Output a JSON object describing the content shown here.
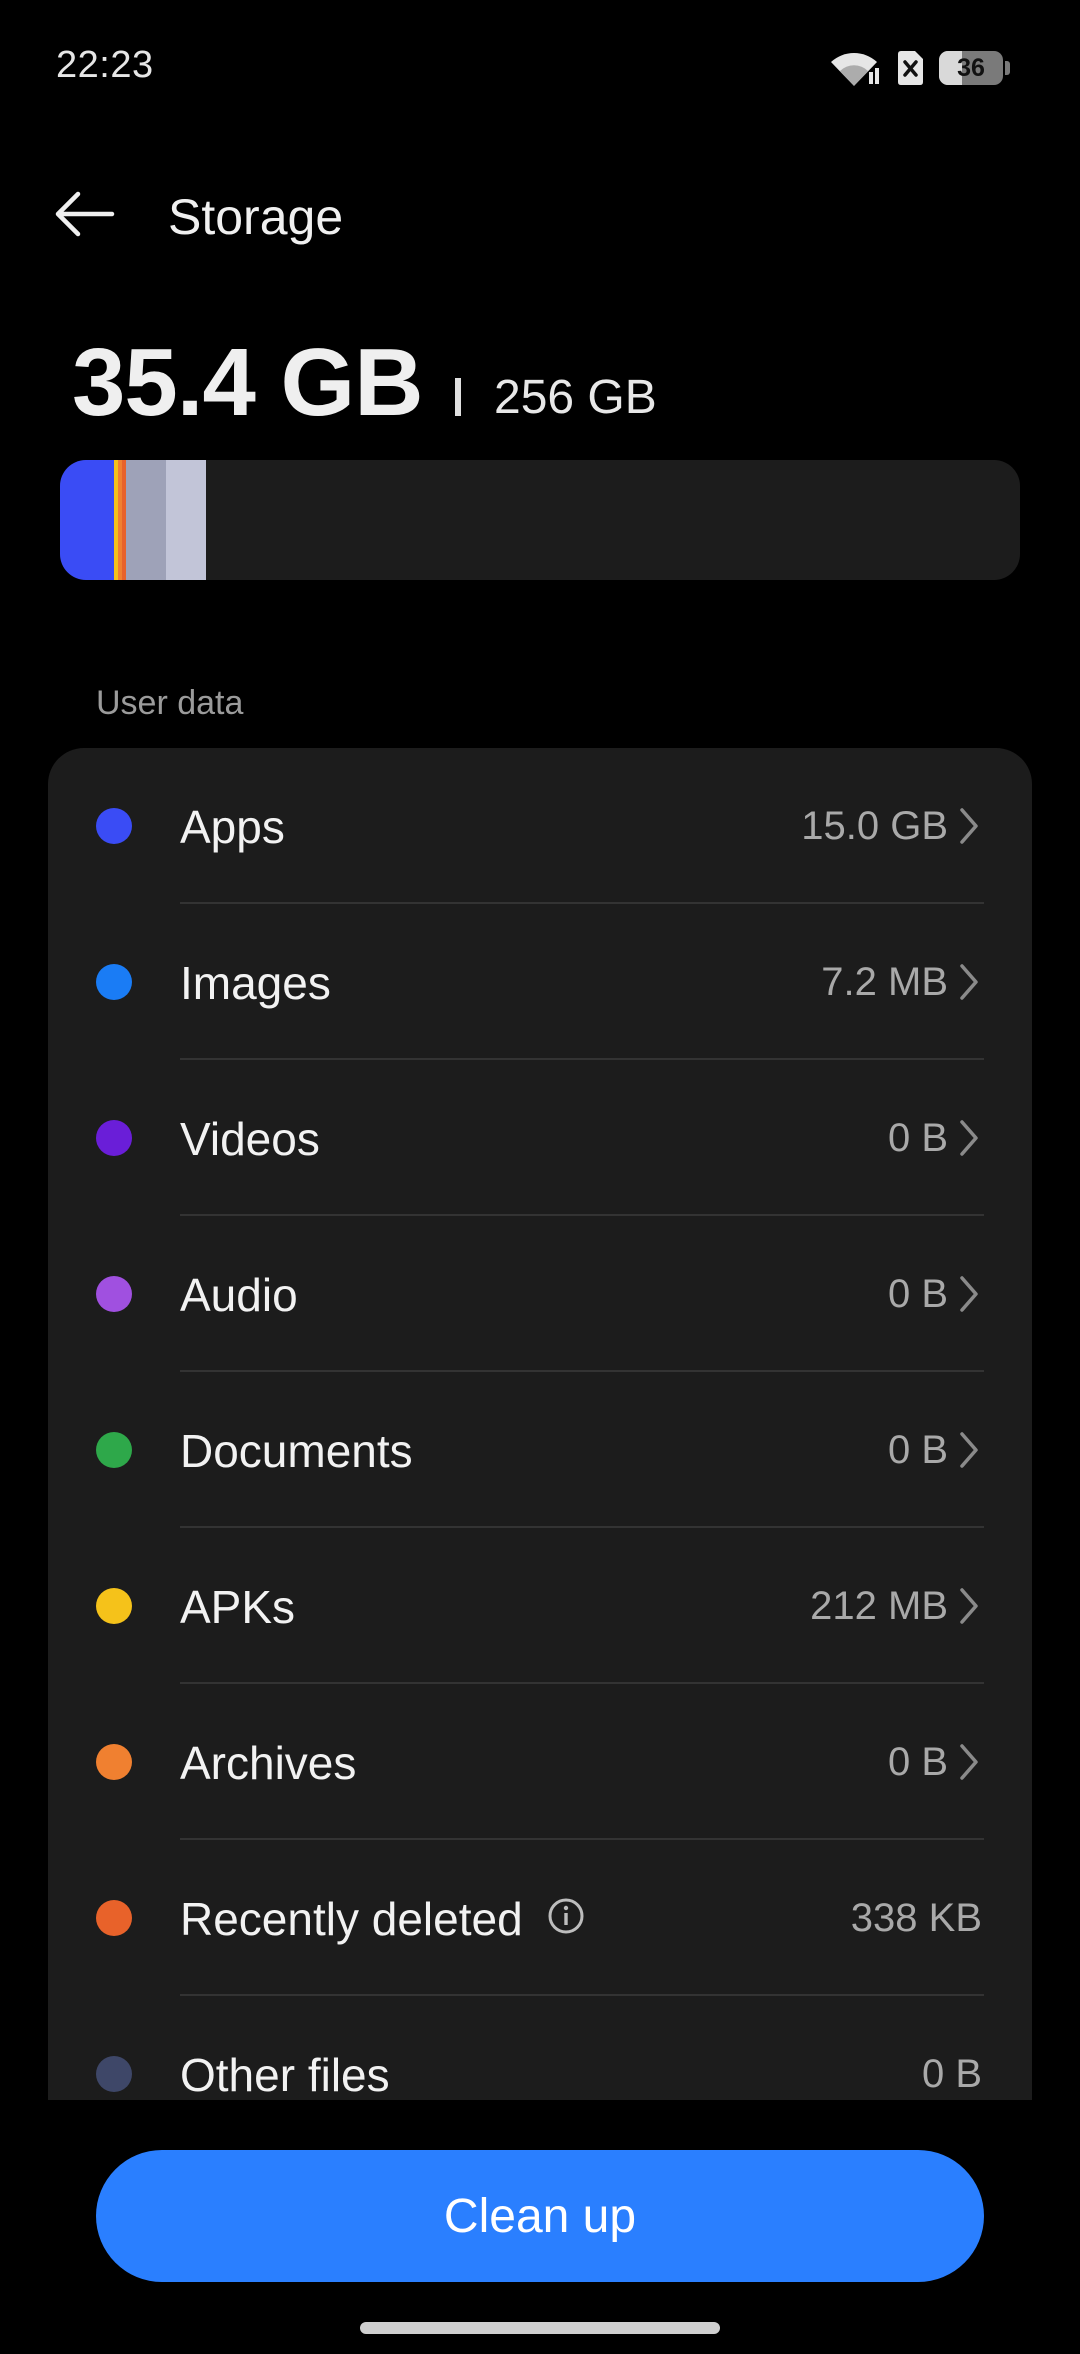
{
  "status_bar": {
    "time": "22:23",
    "battery_level": "36",
    "battery_fraction": 0.36,
    "icons": [
      "wifi-icon",
      "no-sim-icon",
      "battery-icon"
    ]
  },
  "header": {
    "title": "Storage",
    "back_icon": "back-arrow-icon"
  },
  "summary": {
    "used": "35.4 GB",
    "total": "256 GB"
  },
  "usage_bar_segments": [
    {
      "category": "Apps",
      "fraction": 0.056,
      "color": "#3a4cf5"
    },
    {
      "category": "APKs",
      "fraction": 0.004,
      "color": "#f5c21a"
    },
    {
      "category": "Archives",
      "fraction": 0.004,
      "color": "#f08030"
    },
    {
      "category": "Recently deleted",
      "fraction": 0.004,
      "color": "#e8622a"
    },
    {
      "category": "System",
      "fraction": 0.042,
      "color": "#9ea2b8"
    },
    {
      "category": "Other",
      "fraction": 0.042,
      "color": "#c2c5d8"
    }
  ],
  "section": {
    "label": "User data"
  },
  "items": [
    {
      "label": "Apps",
      "value": "15.0 GB",
      "color": "#3a4cf5",
      "chevron": true
    },
    {
      "label": "Images",
      "value": "7.2 MB",
      "color": "#1a7cf5",
      "chevron": true
    },
    {
      "label": "Videos",
      "value": "0 B",
      "color": "#6a1ed8",
      "chevron": true
    },
    {
      "label": "Audio",
      "value": "0 B",
      "color": "#a050e0",
      "chevron": true
    },
    {
      "label": "Documents",
      "value": "0 B",
      "color": "#2ea84a",
      "chevron": true
    },
    {
      "label": "APKs",
      "value": "212 MB",
      "color": "#f5c21a",
      "chevron": true
    },
    {
      "label": "Archives",
      "value": "0 B",
      "color": "#f08030",
      "chevron": true
    },
    {
      "label": "Recently deleted",
      "value": "338 KB",
      "color": "#e8622a",
      "chevron": false,
      "info_icon": true
    },
    {
      "label": "Other files",
      "value": "0 B",
      "color": "#3e4768",
      "chevron": false
    }
  ],
  "actions": {
    "clean_up_label": "Clean up"
  },
  "colors": {
    "accent": "#2a7fff",
    "card_background": "#1c1c1c",
    "background": "#000000"
  }
}
